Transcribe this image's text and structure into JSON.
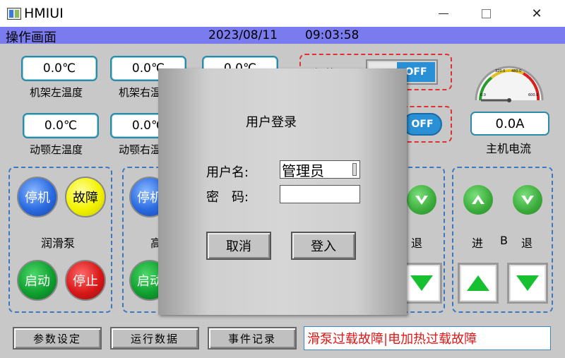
{
  "window": {
    "title": "HMIUI",
    "minimize_glyph": "",
    "maximize_glyph": "",
    "close_glyph": "✕"
  },
  "header": {
    "title": "操作画面",
    "date": "2023/08/11",
    "time": "09:03:58"
  },
  "temperatures": [
    {
      "value": "0.0℃",
      "label": "机架左温度"
    },
    {
      "value": "0.0℃",
      "label": "机架右温度"
    },
    {
      "value": "0.0℃",
      "label": ""
    },
    {
      "value": "0.0℃",
      "label": "动颚左温度"
    },
    {
      "value": "0.0℃",
      "label": "动颚右温度"
    }
  ],
  "heater": {
    "label": "加热器",
    "switch_state": "OFF",
    "pill_state": "OFF"
  },
  "current": {
    "value": "0.0A",
    "label": "主机电流",
    "gauge_ticks": [
      "0.0",
      "320.0",
      "480.0",
      "600.0"
    ],
    "level": 0.0
  },
  "pump1": {
    "stop_label": "停机",
    "fault_label": "故障",
    "name": "润滑泵",
    "start_label": "启动",
    "halt_label": "停止"
  },
  "pump2": {
    "stop_label": "停机",
    "name": "高",
    "start_label": "启动"
  },
  "motor_a": {
    "back_label": "退"
  },
  "motor_b": {
    "forward_label": "进",
    "name": "B",
    "back_label": "退"
  },
  "bottom": {
    "params_label": "参数设定",
    "running_label": "运行数据",
    "events_label": "事件记录",
    "alarm_text": "滑泵过载故障|电加热过载故障"
  },
  "login": {
    "title": "用户登录",
    "username_label": "用户名:",
    "username_value": "管理员",
    "password_label": "密　码:",
    "password_value": "",
    "cancel_label": "取消",
    "login_label": "登入"
  },
  "colors": {
    "header_bg": "#7b7bf0",
    "accent": "#2a90d6",
    "alarm": "#e01818"
  }
}
